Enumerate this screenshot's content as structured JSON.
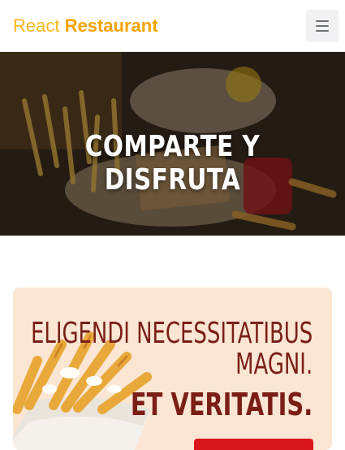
{
  "navbar": {
    "brand_light": "React",
    "brand_bold": "Restaurant",
    "menu_icon": "hamburger-menu-icon"
  },
  "hero": {
    "title": "COMPARTE Y DISFRUTA"
  },
  "promo": {
    "line1": "ELIGENDI NECESSITATIBUS",
    "line2": "MAGNI.",
    "line3": "ET VERITATIS.",
    "button_label": ""
  },
  "colors": {
    "brand": "#f5a300",
    "promo_bg": "#fbe6d4",
    "promo_text": "#7a1e16",
    "cta": "#d9161c"
  }
}
